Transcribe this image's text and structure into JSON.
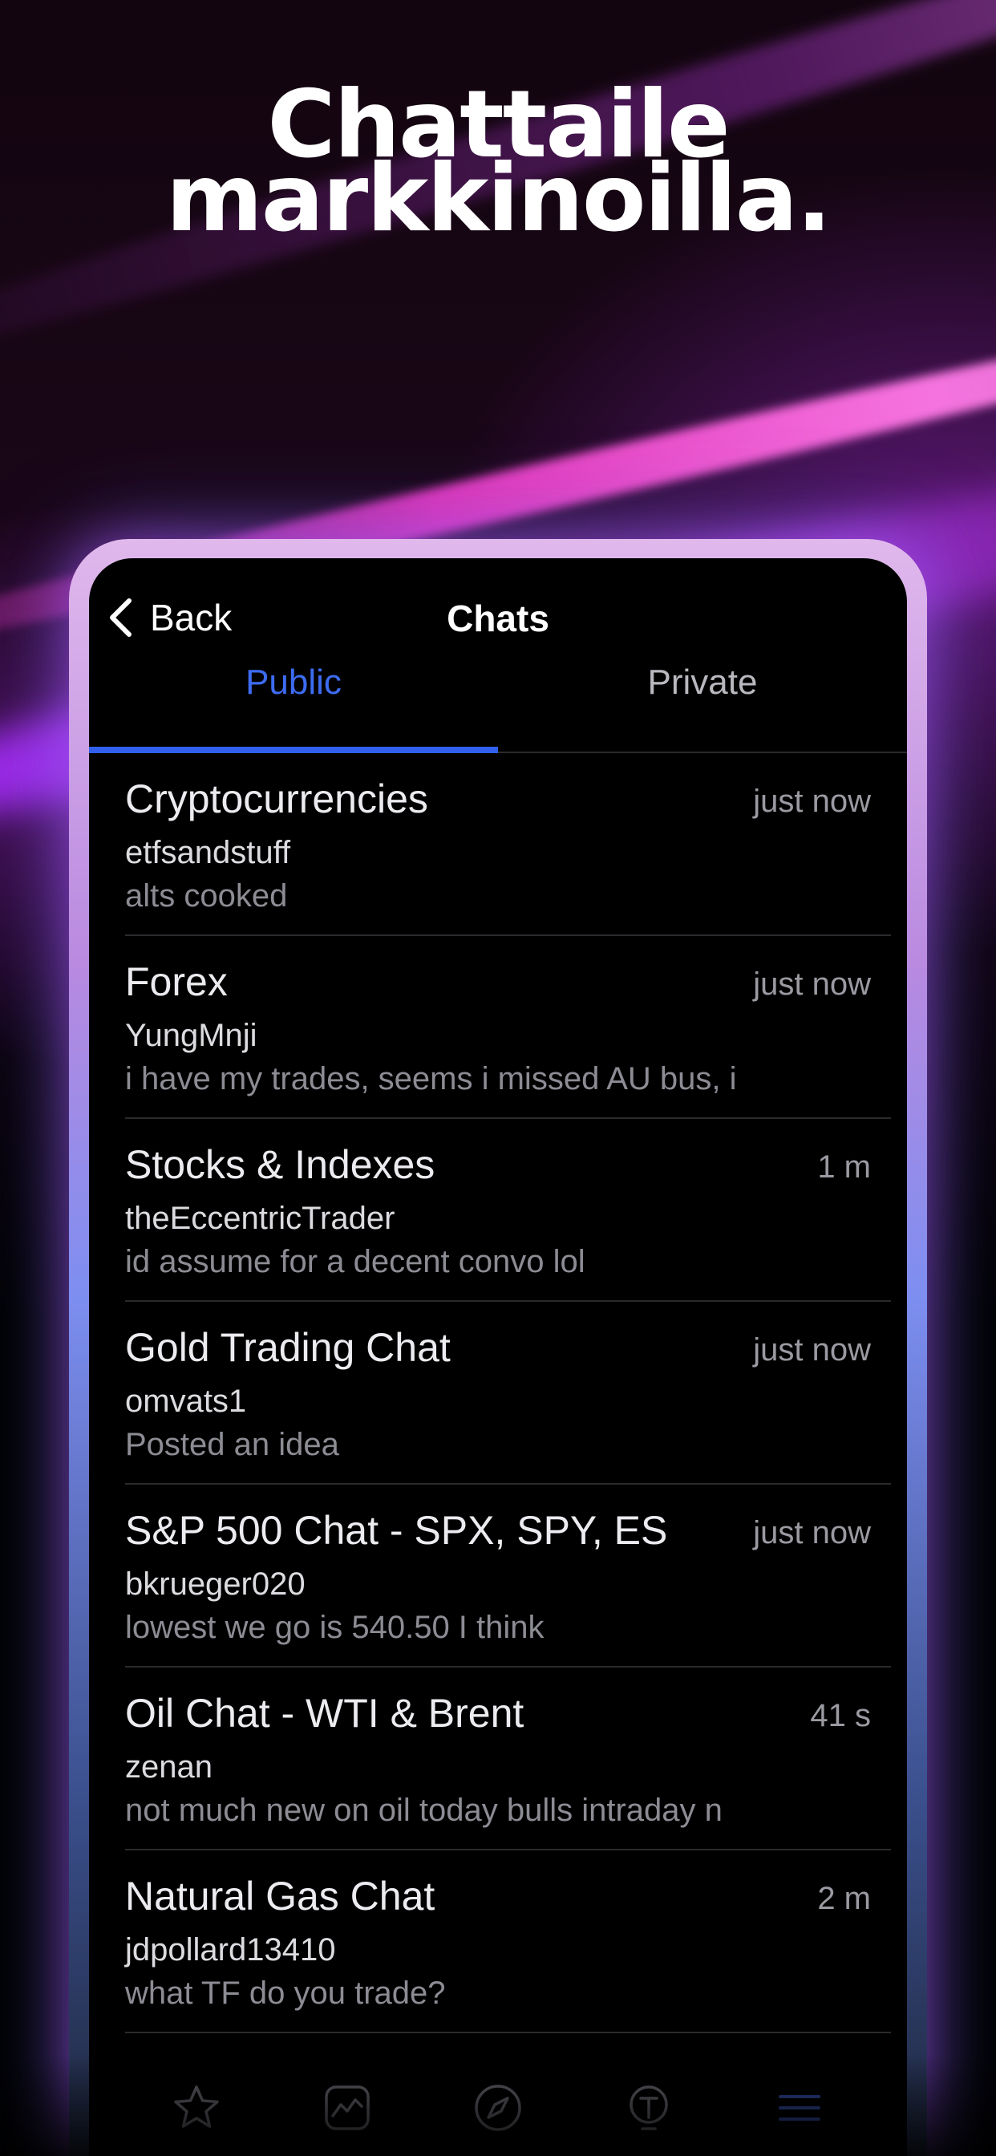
{
  "headline": {
    "line1": "Chattaile",
    "line2": "markkinoilla."
  },
  "navbar": {
    "back_label": "Back",
    "title": "Chats"
  },
  "tabs": [
    {
      "label": "Public",
      "active": true
    },
    {
      "label": "Private",
      "active": false
    }
  ],
  "chats": [
    {
      "title": "Cryptocurrencies",
      "time": "just now",
      "user": "etfsandstuff",
      "message": "alts cooked"
    },
    {
      "title": "Forex",
      "time": "just now",
      "user": "YungMnji",
      "message": "i have my trades, seems i missed AU bus, i"
    },
    {
      "title": "Stocks & Indexes",
      "time": "1 m",
      "user": "theEccentricTrader",
      "message": "id assume for a decent convo lol"
    },
    {
      "title": "Gold Trading Chat",
      "time": "just now",
      "user": "omvats1",
      "message": "Posted an idea"
    },
    {
      "title": "S&P 500 Chat - SPX, SPY, ES",
      "time": "just now",
      "user": "bkrueger020",
      "message": "lowest we go is 540.50 I think"
    },
    {
      "title": "Oil Chat - WTI & Brent",
      "time": "41 s",
      "user": "zenan",
      "message": "not much new on oil today bulls intraday n"
    },
    {
      "title": "Natural Gas Chat",
      "time": "2 m",
      "user": "jdpollard13410",
      "message": " what TF do you trade?"
    }
  ],
  "tabbar": {
    "items": [
      "star-icon",
      "chart-icon",
      "compass-icon",
      "lightbulb-icon",
      "menu-icon"
    ]
  },
  "colors": {
    "accent": "#3d6cf2",
    "indicator": "#3160ee",
    "background": "#000000"
  }
}
